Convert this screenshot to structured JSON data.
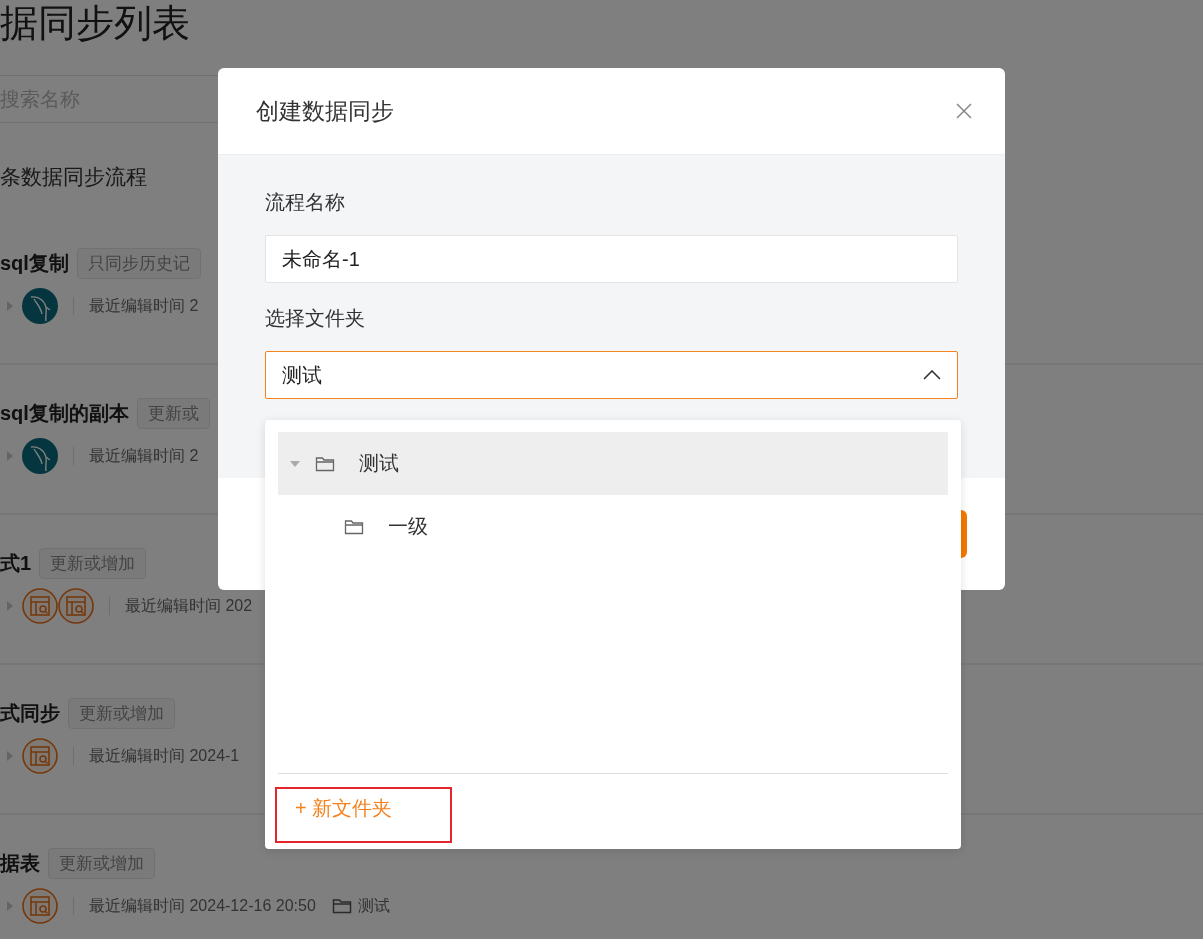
{
  "page": {
    "title": "据同步列表",
    "search": {
      "placeholder": "搜索名称"
    },
    "count_text": "条数据同步流程",
    "flows": [
      {
        "name": "sql复制",
        "tag": "只同步历史记",
        "sources": [
          {
            "kind": "mysql"
          }
        ],
        "edited": "最近编辑时间 2"
      },
      {
        "name": "sql复制的副本",
        "tag": "更新或",
        "sources": [
          {
            "kind": "mysql"
          }
        ],
        "edited": "最近编辑时间 2"
      },
      {
        "name": "式1",
        "tag": "更新或增加",
        "sources": [
          {
            "kind": "table"
          },
          {
            "kind": "table"
          }
        ],
        "edited": "最近编辑时间 202"
      },
      {
        "name": "式同步",
        "tag": "更新或增加",
        "sources": [
          {
            "kind": "table"
          }
        ],
        "edited": "最近编辑时间 2024-1"
      },
      {
        "name": "据表",
        "tag": "更新或增加",
        "sources": [
          {
            "kind": "table"
          }
        ],
        "edited": "最近编辑时间 2024-12-16 20:50",
        "folder": "测试"
      }
    ]
  },
  "modal": {
    "title": "创建数据同步",
    "fields": [
      {
        "kind": "input",
        "label": "流程名称",
        "value": "未命名-1"
      },
      {
        "kind": "select",
        "label": "选择文件夹",
        "value": "测试",
        "expanded": true
      }
    ],
    "dropdown": {
      "tree": [
        {
          "label": "测试",
          "expanded": true,
          "selected": true,
          "children": [
            {
              "label": "一级",
              "selected": false
            }
          ]
        }
      ],
      "action": {
        "label": "+ 新文件夹",
        "highlighted": true
      }
    }
  }
}
